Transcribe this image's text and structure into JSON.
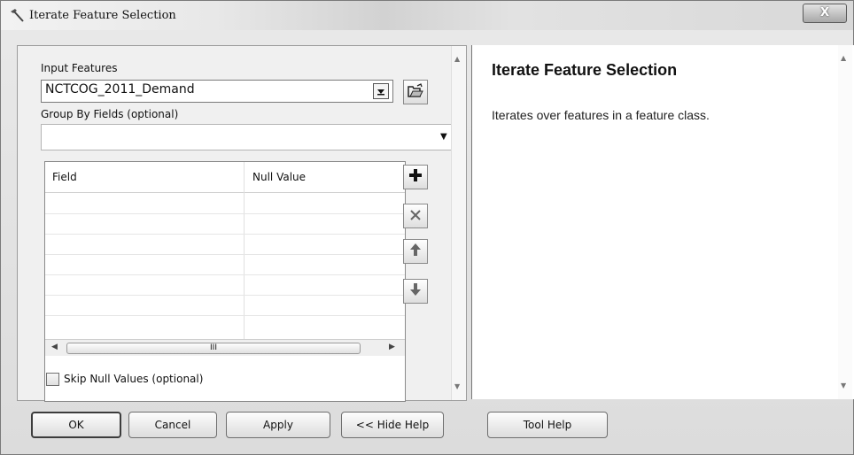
{
  "window": {
    "title": "Iterate Feature Selection",
    "close_label": "X",
    "tool_icon": "hammer-icon"
  },
  "form": {
    "input_features": {
      "label": "Input Features",
      "value": "NCTCOG_2011_Demand",
      "browse_icon": "open-folder-icon"
    },
    "group_by": {
      "label": "Group By Fields (optional)",
      "value": ""
    },
    "table": {
      "columns": [
        "Field",
        "Null Value"
      ],
      "rows": [],
      "scroll_thumb_grip": "III"
    },
    "table_buttons": [
      "add-icon",
      "delete-icon",
      "move-up-icon",
      "move-down-icon"
    ],
    "skip_null": {
      "label": "Skip Null Values (optional)",
      "checked": false
    }
  },
  "help": {
    "title": "Iterate Feature Selection",
    "text": "Iterates over features in a feature class."
  },
  "buttons": {
    "ok": "OK",
    "cancel": "Cancel",
    "apply": "Apply",
    "hide_help": "<< Hide Help",
    "tool_help": "Tool Help"
  }
}
